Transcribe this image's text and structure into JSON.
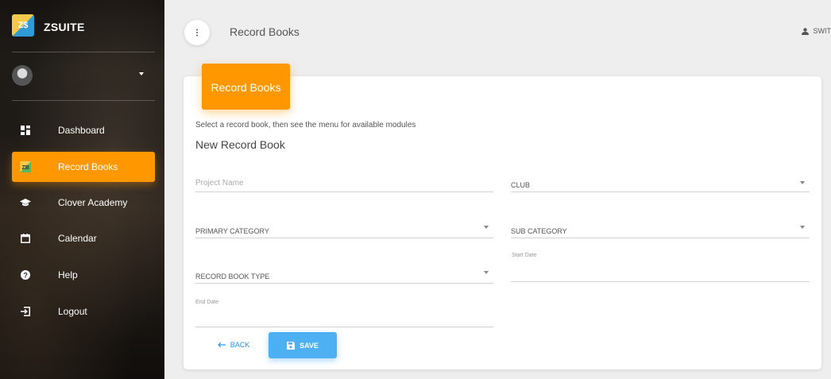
{
  "app": {
    "name": "ZSUITE",
    "logo_text": "Z$"
  },
  "sidebar": {
    "items": [
      {
        "label": "Dashboard",
        "icon": "dashboard-icon"
      },
      {
        "label": "Record Books",
        "icon": "record-books-icon",
        "active": true
      },
      {
        "label": "Clover Academy",
        "icon": "graduation-cap-icon"
      },
      {
        "label": "Calendar",
        "icon": "calendar-icon"
      },
      {
        "label": "Help",
        "icon": "help-icon"
      },
      {
        "label": "Logout",
        "icon": "logout-icon"
      }
    ]
  },
  "header": {
    "title": "Record Books",
    "switch_label": "SWIT"
  },
  "card": {
    "header_label": "Record Books",
    "hint": "Select a record book, then see the menu for available modules",
    "form_title": "New Record Book"
  },
  "form": {
    "project_name_placeholder": "Project Name",
    "club_label": "CLUB",
    "primary_category_label": "PRIMARY CATEGORY",
    "sub_category_label": "SUB CATEGORY",
    "start_date_label": "Start Date",
    "record_book_type_label": "RECORD BOOK TYPE",
    "end_date_label": "End Date"
  },
  "buttons": {
    "back_label": "BACK",
    "save_label": "SAVE"
  },
  "colors": {
    "accent": "#ff9800",
    "primary": "#4db0f3",
    "link": "#2196f3"
  }
}
